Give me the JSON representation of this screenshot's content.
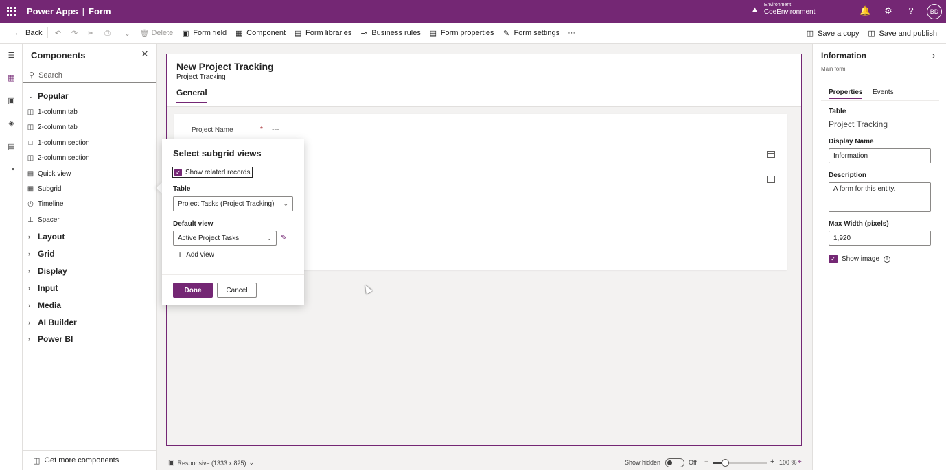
{
  "header": {
    "app_name": "Power Apps",
    "separator": "|",
    "page_name": "Form",
    "environment_label": "Environment",
    "environment_name": "CoeEnvironment",
    "user_initials": "BD"
  },
  "commandbar": {
    "back": "Back",
    "delete": "Delete",
    "form_field": "Form field",
    "component": "Component",
    "form_libraries": "Form libraries",
    "business_rules": "Business rules",
    "form_properties": "Form properties",
    "form_settings": "Form settings",
    "more": "···",
    "save_copy": "Save a copy",
    "save_publish": "Save and publish"
  },
  "components": {
    "title": "Components",
    "search_placeholder": "Search",
    "popular_label": "Popular",
    "popular_items": [
      {
        "label": "1-column tab",
        "icon": "tab-1col-icon"
      },
      {
        "label": "2-column tab",
        "icon": "tab-2col-icon"
      },
      {
        "label": "1-column section",
        "icon": "section-1col-icon"
      },
      {
        "label": "2-column section",
        "icon": "section-2col-icon"
      },
      {
        "label": "Quick view",
        "icon": "quick-view-icon"
      },
      {
        "label": "Subgrid",
        "icon": "subgrid-icon"
      },
      {
        "label": "Timeline",
        "icon": "timeline-icon"
      },
      {
        "label": "Spacer",
        "icon": "spacer-icon"
      }
    ],
    "groups": [
      "Layout",
      "Grid",
      "Display",
      "Input",
      "Media",
      "AI Builder",
      "Power BI"
    ],
    "get_more": "Get more components"
  },
  "form": {
    "title": "New Project Tracking",
    "subtitle": "Project Tracking",
    "tab": "General",
    "field_label": "Project Name",
    "required_mark": "*",
    "field_value": "---"
  },
  "dialog": {
    "title": "Select subgrid views",
    "show_related": "Show related records",
    "table_label": "Table",
    "table_value": "Project Tasks (Project Tracking)",
    "default_view_label": "Default view",
    "default_view_value": "Active Project Tasks",
    "add_view": "Add view",
    "done": "Done",
    "cancel": "Cancel"
  },
  "status": {
    "layout": "Responsive (1333 x 825)",
    "show_hidden": "Show hidden",
    "toggle_state": "Off",
    "zoom": "100 %",
    "zoom_slider_fraction": 0.22
  },
  "properties": {
    "title": "Information",
    "subtitle": "Main form",
    "tab_properties": "Properties",
    "tab_events": "Events",
    "table_label": "Table",
    "table_value": "Project Tracking",
    "display_name_label": "Display Name",
    "display_name_value": "Information",
    "description_label": "Description",
    "description_value": "A form for this entity.",
    "max_width_label": "Max Width (pixels)",
    "max_width_value": "1,920",
    "show_image": "Show image"
  },
  "colors": {
    "brand": "#742774",
    "danger": "#a4262c"
  }
}
